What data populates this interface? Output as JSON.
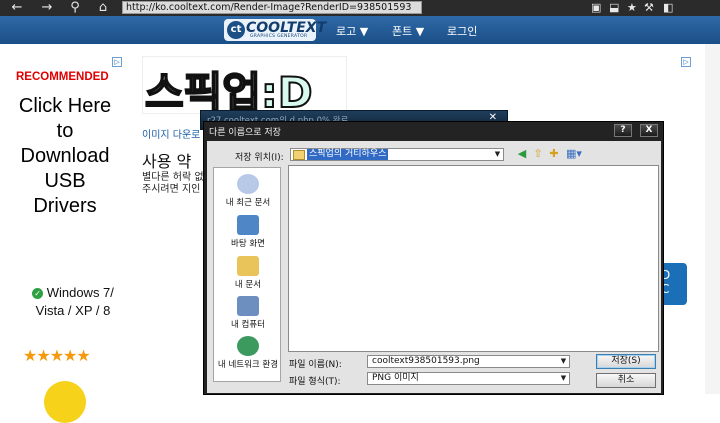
{
  "browser": {
    "url": "http://ko.cooltext.com/Render-Image?RenderID=938501593",
    "icons": [
      "back-arrow-icon",
      "forward-arrow-icon",
      "search-icon",
      "home-icon"
    ],
    "right_icons": [
      "page-icon",
      "save-icon",
      "star-icon",
      "tools-icon",
      "window-icon"
    ]
  },
  "site": {
    "logo_text": "COOLTEXT",
    "logo_sub": "GRAPHICS GENERATOR",
    "menu": [
      "로고 ▼",
      "폰트 ▼",
      "로그인"
    ]
  },
  "ad": {
    "recommended": "RECOMMENDED",
    "headline_lines": [
      "Click Here",
      "to",
      "Download",
      "USB",
      "Drivers"
    ],
    "os_line1": "Windows 7/",
    "os_line2": "Vista / XP / 8",
    "stars": "★★★★★"
  },
  "content": {
    "stylized_text": "스픽업:D",
    "link_text": "이미지 다운로",
    "heading": "사용 약",
    "text1": "별다른 허락 없",
    "text2": "주시려면 지인"
  },
  "background_window": {
    "title": "r27 cooltext.com의 d.php 0% 완료"
  },
  "side_button": {
    "text": "D\nC"
  },
  "dialog": {
    "title": "다른 이름으로 저장",
    "help": "?",
    "close": "X",
    "location_label": "저장 위치(I):",
    "location_value": "스픽업의 거티하우스",
    "places": [
      "내 최근 문서",
      "바탕 화면",
      "내 문서",
      "내 컴퓨터",
      "내 네트워크 환경"
    ],
    "filename_label": "파일 이름(N):",
    "filename_value": "cooltext938501593.png",
    "filetype_label": "파일 형식(T):",
    "filetype_value": "PNG 이미지",
    "save_button": "저장(S)",
    "cancel_button": "취소"
  },
  "colors": {
    "header_blue": "#1b4f86",
    "recommended_red": "#e00000",
    "selection_blue": "#316ac5"
  }
}
